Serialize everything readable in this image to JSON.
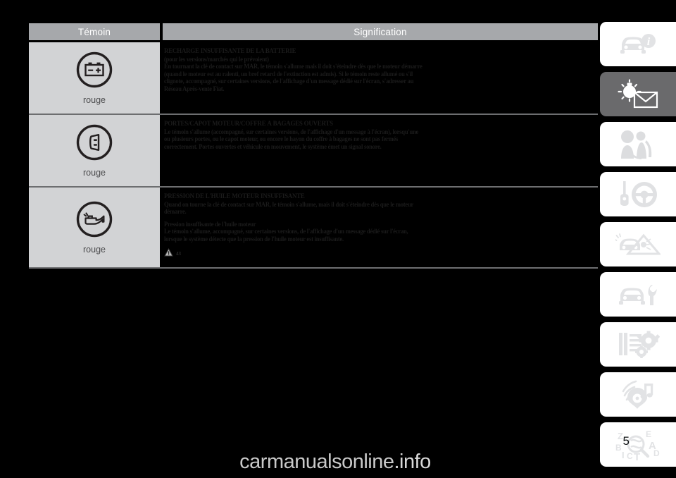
{
  "document": {
    "page_background": "#000000",
    "page_number": "5"
  },
  "table": {
    "headers": {
      "temoin": "Témoin",
      "signification": "Signification"
    },
    "header_bg": "#a6a8ab",
    "temoin_cell_bg": "#d2d3d5",
    "rows": [
      {
        "icon": "battery-icon",
        "color_label": "rouge",
        "lines": [
          {
            "style": "head",
            "text": "RECHARGE INSUFFISANTE DE LA BATTERIE"
          },
          {
            "style": "sub",
            "text": "(pour les versions/marchés qui le prévoient)"
          },
          {
            "style": "sub",
            "text": "En tournant la clé de contact sur MAR, le témoin s'allume mais il doit s'éteindre dès que le moteur démarre"
          },
          {
            "style": "sub",
            "text": "(quand le moteur est au ralenti, un bref retard de l'extinction est admis). Si le témoin reste allumé ou s'il"
          },
          {
            "style": "sub",
            "text": "clignote, accompagné, sur certaines versions, de l'affichage d'un message dédié sur l'écran, s'adresser au"
          },
          {
            "style": "sub",
            "text": "Réseau Après-vente Fiat."
          }
        ],
        "note": null
      },
      {
        "icon": "door-open-icon",
        "color_label": "rouge",
        "lines": [
          {
            "style": "head",
            "text": "PORTES/CAPOT MOTEUR/COFFRE À BAGAGES OUVERTS"
          },
          {
            "style": "sub",
            "text": "Le témoin s'allume (accompagné, sur certaines versions, de l'affichage d'un message à l'écran), lorsqu'une"
          },
          {
            "style": "sub",
            "text": "ou plusieurs portes, ou le capot moteur, ou encore le hayon du coffre à bagages ne sont pas fermés"
          },
          {
            "style": "sub",
            "text": "correctement. Portes ouvertes et véhicule en mouvement, le système émet un signal sonore."
          }
        ],
        "note": null
      },
      {
        "icon": "oil-pressure-icon",
        "color_label": "rouge",
        "lines": [
          {
            "style": "head",
            "text": "PRESSION DE L'HUILE MOTEUR INSUFFISANTE"
          },
          {
            "style": "sub",
            "text": "Quand on tourne la clé de contact sur MAR, le témoin s'allume, mais il doit s'éteindre dès que le moteur"
          },
          {
            "style": "sub",
            "text": "démarre."
          },
          {
            "style": "gap",
            "text": "Pression insuffisante de l'huile moteur"
          },
          {
            "style": "sub",
            "text": "Le témoin s'allume, accompagné, sur certaines versions, de l'affichage d'un message dédié sur l'écran,"
          },
          {
            "style": "sub",
            "text": "lorsque le système détecte que la pression de l'huile moteur est insuffisante."
          }
        ],
        "note": {
          "icon": "warning-triangle-icon",
          "text": "43"
        }
      }
    ]
  },
  "sidebar": {
    "tabs": [
      {
        "name": "car-info",
        "icon": "car-info-icon",
        "active": false
      },
      {
        "name": "dashboard-messages",
        "icon": "lamp-envelope-icon",
        "active": true
      },
      {
        "name": "safety",
        "icon": "occupant-seatbelt-icon",
        "active": false
      },
      {
        "name": "starting-driving",
        "icon": "key-steering-icon",
        "active": false
      },
      {
        "name": "emergency",
        "icon": "car-warning-icon",
        "active": false
      },
      {
        "name": "maintenance",
        "icon": "car-wrench-icon",
        "active": false
      },
      {
        "name": "technical-specs",
        "icon": "list-gears-icon",
        "active": false
      },
      {
        "name": "multimedia",
        "icon": "music-signal-icon",
        "active": false
      },
      {
        "name": "index",
        "icon": "alphabet-search-icon",
        "active": false
      }
    ]
  },
  "watermark": {
    "text_main": "carmanualsonline",
    "text_suffix": ".info"
  }
}
